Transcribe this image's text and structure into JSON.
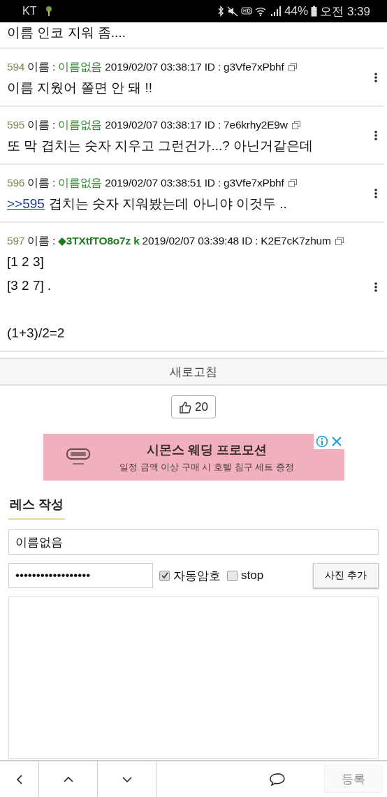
{
  "status_bar": {
    "carrier": "KT",
    "battery": "44%",
    "time": "오전 3:39"
  },
  "partial_post": {
    "body": "이름 인코 지워 좀...."
  },
  "posts": [
    {
      "number": "594",
      "name_label": "이름 :",
      "name": "이름없음",
      "trip": false,
      "date": "2019/02/07 03:38:17",
      "id_label": "ID :",
      "id": "g3Vfe7xPbhf",
      "paragraphs": [
        [
          "이름 지웠어 쫄면 안 돼 !!"
        ]
      ]
    },
    {
      "number": "595",
      "name_label": "이름 :",
      "name": "이름없음",
      "trip": false,
      "date": "2019/02/07 03:38:17",
      "id_label": "ID :",
      "id": "7e6krhy2E9w",
      "paragraphs": [
        [
          "또 막 겹치는 숫자 지우고 그런건가...? 아닌거같은데"
        ]
      ]
    },
    {
      "number": "596",
      "name_label": "이름 :",
      "name": "이름없음",
      "trip": false,
      "date": "2019/02/07 03:38:51",
      "id_label": "ID :",
      "id": "g3Vfe7xPbhf",
      "reply_link": ">>595",
      "paragraphs": [
        [
          "겹치는 숫자 지워봤는데 아니야 이것두 .."
        ]
      ]
    },
    {
      "number": "597",
      "name_label": "이름 :",
      "name": "◆3TXtfTO8o7z k",
      "trip": true,
      "date": "2019/02/07 03:39:48",
      "id_label": "ID :",
      "id": "K2E7cK7zhum",
      "paragraphs": [
        [
          "[1 2 3]",
          "[3 2 7] ."
        ],
        [
          "(1+3)/2=2"
        ]
      ]
    }
  ],
  "refresh_button": "새로고침",
  "like_button": {
    "count": "20"
  },
  "ad": {
    "title": "시몬스 웨딩 프로모션",
    "subtitle": "일정 금액 이상 구매 시 호텔 침구 세트 증정"
  },
  "reply_form": {
    "heading": "레스 작성",
    "name_field": {
      "value": "이름없음"
    },
    "password_field": {
      "value": "••••••••••••••••••"
    },
    "checkboxes": [
      {
        "label": "자동암호",
        "checked": true
      },
      {
        "label": "stop",
        "checked": false
      }
    ],
    "photo_button": "사진 추가"
  },
  "bottom_bar": {
    "submit_button": {
      "label": "등록",
      "disabled": true
    }
  }
}
